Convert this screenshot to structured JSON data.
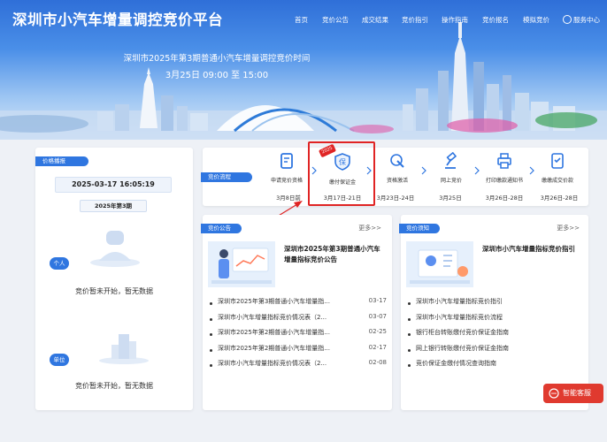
{
  "header": {
    "site_title": "深圳市小汽车增量调控竞价平台",
    "nav": [
      "首页",
      "竞价公告",
      "成交结果",
      "竞价指引",
      "操作指南",
      "竞价报名",
      "模拟竞价",
      "服务中心"
    ],
    "hero_title": "深圳市2025年第3期普通小汽车增量调控竞价时间",
    "hero_time": "3月25日 09:00 至 15:00"
  },
  "price_panel": {
    "ribbon": "价格播报",
    "datetime": "2025-03-17 16:05:19",
    "period": "2025年第3期",
    "personal_badge": "个人",
    "personal_status": "竞价暂未开始，暂无数据",
    "company_badge": "单位",
    "company_status": "竞价暂未开始，暂无数据"
  },
  "process": {
    "ribbon": "竞价流程",
    "steps": [
      {
        "label": "申请竞价资格",
        "date": "3月8日前",
        "icon": "form-icon"
      },
      {
        "label": "缴付保证金",
        "date": "3月17日-21日",
        "icon": "shield-deposit-icon",
        "badge": "2025"
      },
      {
        "label": "资格激活",
        "date": "3月23日-24日",
        "icon": "cursor-click-icon"
      },
      {
        "label": "网上竞价",
        "date": "3月25日",
        "icon": "gavel-icon"
      },
      {
        "label": "打印缴款通知书",
        "date": "3月26日-28日",
        "icon": "printer-icon"
      },
      {
        "label": "缴缴成交价款",
        "date": "3月26日-28日",
        "icon": "payment-doc-icon"
      }
    ]
  },
  "announcements": {
    "ribbon": "竞价公告",
    "more": "更多>>",
    "featured": "深圳市2025年第3期普通小汽车增量指标竞价公告",
    "items": [
      {
        "title": "深圳市2025年第3期普通小汽车增量指...",
        "date": "03-17"
      },
      {
        "title": "深圳市小汽车增量指标竞价情况表（2...",
        "date": "03-07"
      },
      {
        "title": "深圳市2025年第2期普通小汽车增量指...",
        "date": "02-25"
      },
      {
        "title": "深圳市2025年第2期普通小汽车增量指...",
        "date": "02-17"
      },
      {
        "title": "深圳市小汽车增量指标竞价情况表（2...",
        "date": "02-08"
      }
    ]
  },
  "notices": {
    "ribbon": "竞价须知",
    "more": "更多>>",
    "featured": "深圳市小汽车增量指标竞价指引",
    "items": [
      {
        "title": "深圳市小汽车增量指标竞价指引"
      },
      {
        "title": "深圳市小汽车增量指标竞价流程"
      },
      {
        "title": "银行柜台转账缴付竞价保证金指南"
      },
      {
        "title": "网上银行转账缴付竞价保证金指南"
      },
      {
        "title": "竞价保证金缴付情况查询指南"
      }
    ]
  },
  "service_button": "智能客服",
  "colors": {
    "primary": "#2f76e0",
    "highlight": "#e02424",
    "header": "#3a7fe0"
  }
}
